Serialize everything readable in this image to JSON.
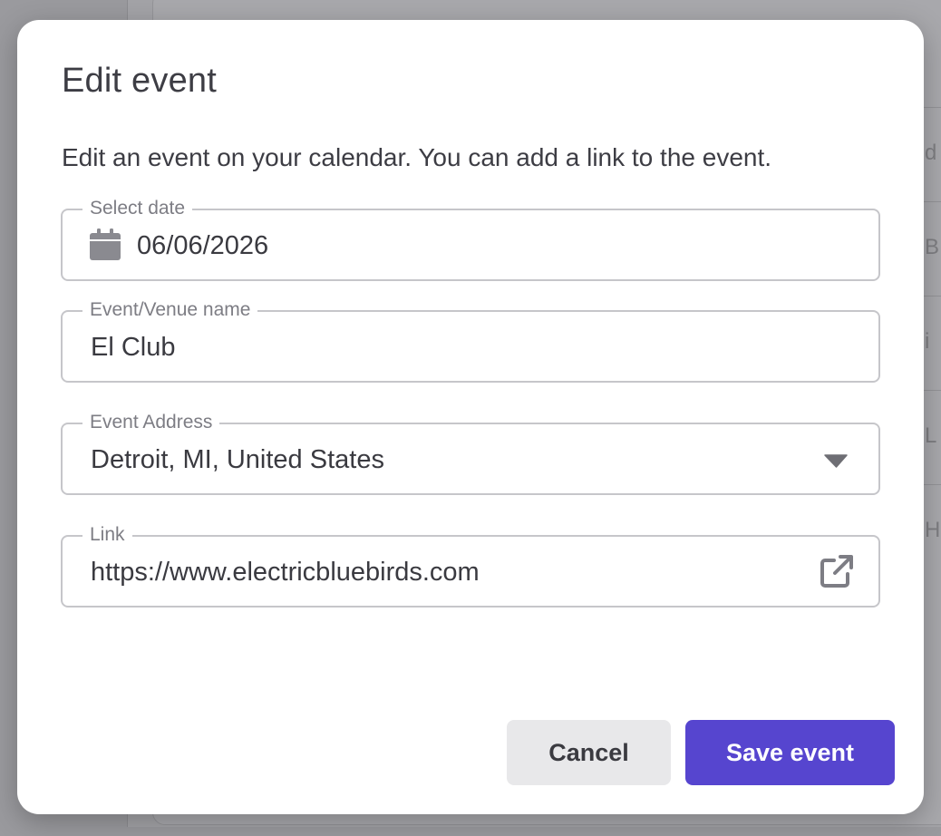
{
  "background": {
    "row_letters": [
      "d",
      "B",
      "i",
      "L",
      "H"
    ]
  },
  "modal": {
    "title": "Edit event",
    "description": "Edit an event on your calendar. You can add a link to the event.",
    "fields": {
      "date": {
        "label": "Select date",
        "value": "06/06/2026",
        "icon": "calendar-icon"
      },
      "venue": {
        "label": "Event/Venue name",
        "value": "El Club"
      },
      "address": {
        "label": "Event Address",
        "value": "Detroit, MI, United States",
        "icon": "chevron-down-icon"
      },
      "link": {
        "label": "Link",
        "value": "https://www.electricbluebirds.com",
        "icon": "external-link-icon"
      }
    },
    "buttons": {
      "cancel": "Cancel",
      "save": "Save event"
    }
  },
  "colors": {
    "accent": "#5645cf",
    "text": "#3a3a40",
    "label": "#7d7d84",
    "border": "#c6c6ca",
    "icon": "#8a8a90"
  }
}
